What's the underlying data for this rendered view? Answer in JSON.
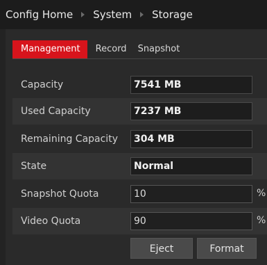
{
  "breadcrumb": {
    "items": [
      "Config Home",
      "System",
      "Storage"
    ]
  },
  "tabs": [
    {
      "label": "Management",
      "active": true
    },
    {
      "label": "Record",
      "active": false
    },
    {
      "label": "Snapshot",
      "active": false
    }
  ],
  "fields": {
    "capacity": {
      "label": "Capacity",
      "value": "7541 MB"
    },
    "used": {
      "label": "Used Capacity",
      "value": "7237 MB"
    },
    "remaining": {
      "label": "Remaining Capacity",
      "value": "304 MB"
    },
    "state": {
      "label": "State",
      "value": "Normal"
    },
    "snapshot_quota": {
      "label": "Snapshot Quota",
      "value": "10",
      "unit": "%"
    },
    "video_quota": {
      "label": "Video Quota",
      "value": "90",
      "unit": "%"
    }
  },
  "buttons": {
    "eject": "Eject",
    "format": "Format"
  },
  "colors": {
    "accent": "#d7141c",
    "background": "#232323"
  }
}
